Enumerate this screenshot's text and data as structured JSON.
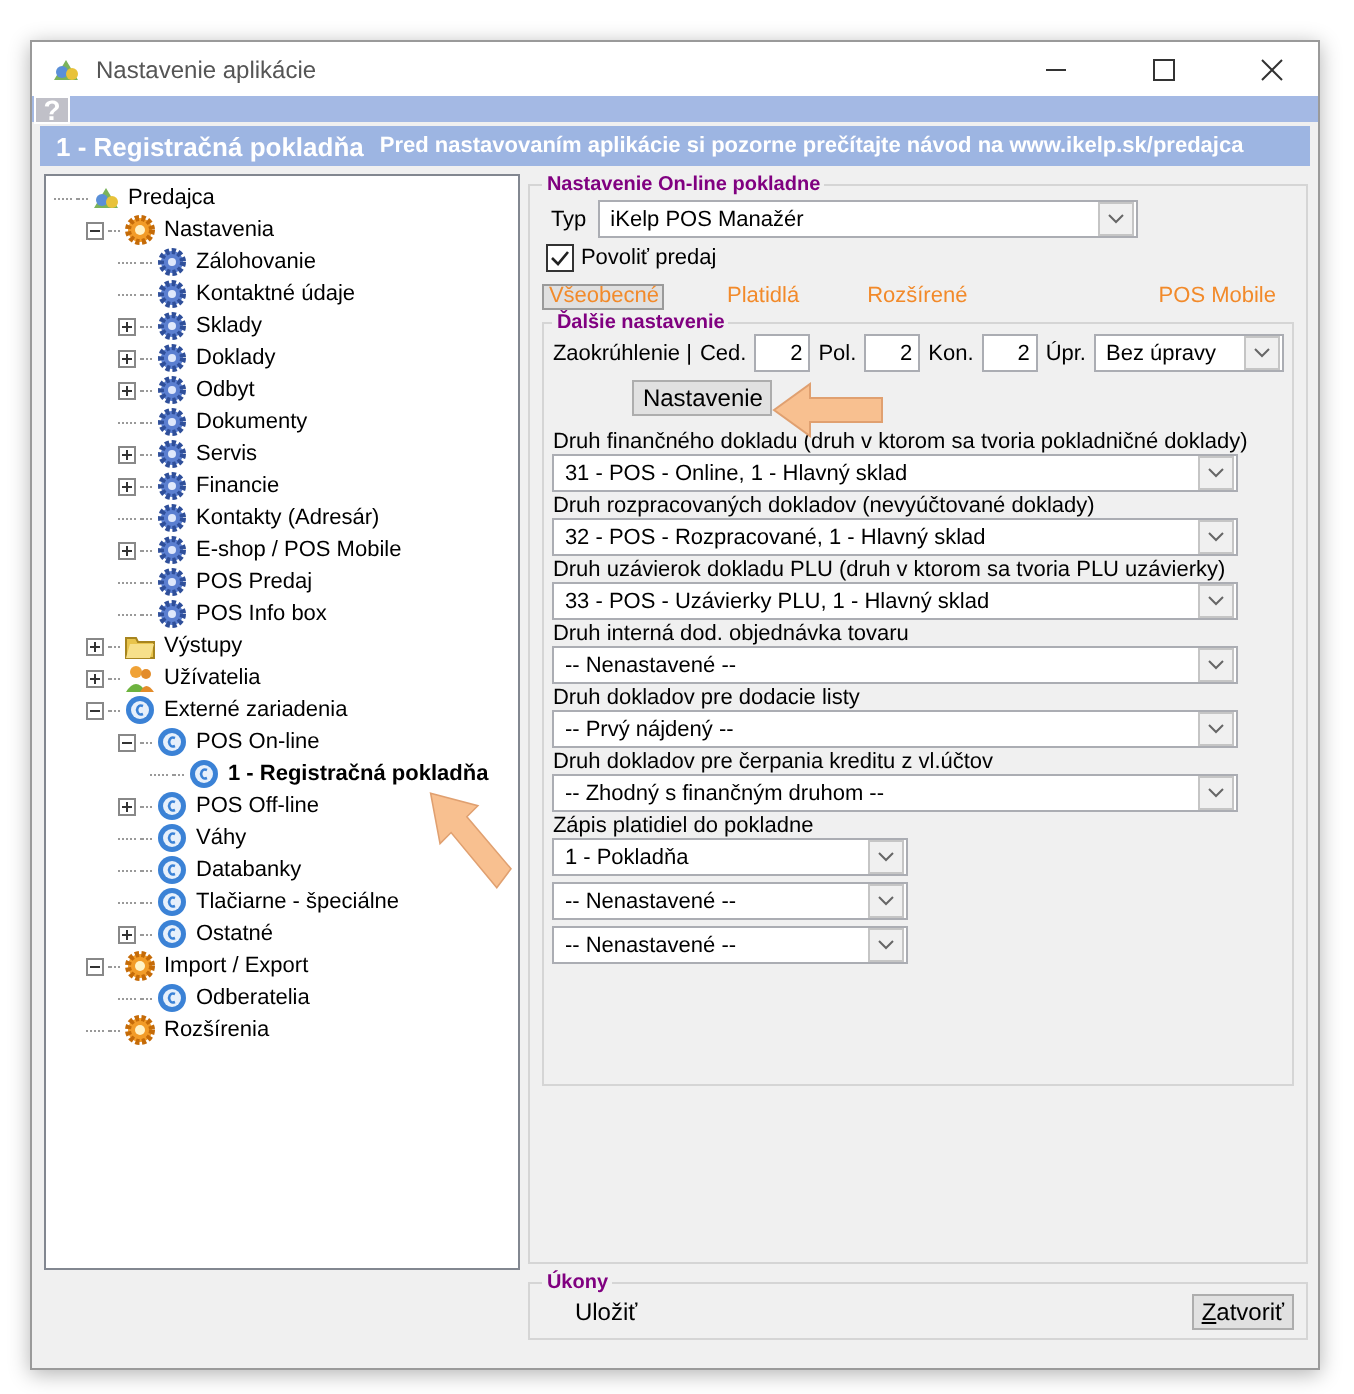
{
  "window": {
    "title": "Nastavenie aplikácie"
  },
  "help": {
    "label": "?"
  },
  "header": {
    "title": "1 - Registračná pokladňa",
    "notice": "Pred nastavovaním aplikácie si pozorne prečítajte návod na www.ikelp.sk/predajca"
  },
  "tree": [
    {
      "label": "Predajca",
      "kind": "app",
      "selected": false,
      "children": [
        {
          "label": "Nastavenia",
          "kind": "gear",
          "expanded": true,
          "selected": false,
          "children": [
            {
              "label": "Zálohovanie",
              "kind": "cog",
              "selected": false
            },
            {
              "label": "Kontaktné údaje",
              "kind": "cog",
              "selected": false
            },
            {
              "label": "Sklady",
              "kind": "cog",
              "expanded": false,
              "selected": false
            },
            {
              "label": "Doklady",
              "kind": "cog",
              "expanded": false,
              "selected": false
            },
            {
              "label": "Odbyt",
              "kind": "cog",
              "expanded": false,
              "selected": false
            },
            {
              "label": "Dokumenty",
              "kind": "cog",
              "selected": false
            },
            {
              "label": "Servis",
              "kind": "cog",
              "expanded": false,
              "selected": false
            },
            {
              "label": "Financie",
              "kind": "cog",
              "expanded": false,
              "selected": false
            },
            {
              "label": "Kontakty (Adresár)",
              "kind": "cog",
              "selected": false
            },
            {
              "label": "E-shop / POS Mobile",
              "kind": "cog",
              "expanded": false,
              "selected": false
            },
            {
              "label": "POS Predaj",
              "kind": "cog",
              "selected": false
            },
            {
              "label": "POS Info box",
              "kind": "cog",
              "selected": false
            }
          ]
        },
        {
          "label": "Výstupy",
          "kind": "folder",
          "expanded": false,
          "selected": false
        },
        {
          "label": "Užívatelia",
          "kind": "users",
          "expanded": false,
          "selected": false
        },
        {
          "label": "Externé zariadenia",
          "kind": "coin",
          "expanded": true,
          "selected": false,
          "children": [
            {
              "label": "POS On-line",
              "kind": "coin",
              "expanded": true,
              "selected": false,
              "children": [
                {
                  "label": "1 - Registračná pokladňa",
                  "kind": "coin",
                  "selected": true
                }
              ]
            },
            {
              "label": "POS Off-line",
              "kind": "coin",
              "expanded": false,
              "selected": false
            },
            {
              "label": "Váhy",
              "kind": "coin",
              "selected": false
            },
            {
              "label": "Databanky",
              "kind": "coin",
              "selected": false
            },
            {
              "label": "Tlačiarne - špeciálne",
              "kind": "coin",
              "selected": false
            },
            {
              "label": "Ostatné",
              "kind": "coin",
              "expanded": false,
              "selected": false
            }
          ]
        },
        {
          "label": "Import / Export",
          "kind": "gear",
          "expanded": true,
          "selected": false,
          "children": [
            {
              "label": "Odberatelia",
              "kind": "coin",
              "selected": false
            }
          ]
        },
        {
          "label": "Rozšírenia",
          "kind": "gear",
          "selected": false
        }
      ]
    }
  ],
  "settings": {
    "legend": "Nastavenie On-line pokladne",
    "type": {
      "label": "Typ",
      "value": "iKelp POS Manažér"
    },
    "enable_sale": {
      "label": "Povoliť predaj",
      "checked": true
    },
    "tabs": [
      {
        "label": "Všeobecné",
        "selected": true
      },
      {
        "label": "Platidlá",
        "selected": false
      },
      {
        "label": "Rozšírené",
        "selected": false
      },
      {
        "label": "POS Mobile",
        "selected": false
      }
    ],
    "more": {
      "legend": "Ďalšie nastavenie",
      "rounding": {
        "label": "Zaokrúhlenie |",
        "fields": [
          {
            "label": "Ced.",
            "value": "2"
          },
          {
            "label": "Pol.",
            "value": "2"
          },
          {
            "label": "Kon.",
            "value": "2"
          }
        ],
        "adjust_label": "Úpr.",
        "adjust_value": "Bez úpravy"
      },
      "button": "Nastavenie",
      "selects": [
        {
          "label": "Druh finančného dokladu (druh v ktorom sa tvoria pokladničné doklady)",
          "value": "31 - POS - Online, 1 - Hlavný sklad"
        },
        {
          "label": "Druh rozpracovaných dokladov (nevyúčtované doklady)",
          "value": "32 - POS - Rozpracované, 1 - Hlavný sklad"
        },
        {
          "label": "Druh uzávierok dokladu PLU (druh v ktorom sa tvoria PLU uzávierky)",
          "value": "33 - POS - Uzávierky PLU, 1 - Hlavný sklad"
        },
        {
          "label": "Druh interná dod. objednávka tovaru",
          "value": "-- Nenastavené --"
        },
        {
          "label": "Druh dokladov pre dodacie listy",
          "value": "-- Prvý nájdený --"
        },
        {
          "label": "Druh dokladov pre čerpania kreditu z vl.účtov",
          "value": "-- Zhodný s finančným druhom --"
        }
      ],
      "payments": {
        "label": "Zápis platidiel do pokladne",
        "values": [
          "1 - Pokladňa",
          "-- Nenastavené --",
          "-- Nenastavené --"
        ]
      }
    }
  },
  "actions": {
    "legend": "Úkony",
    "save": "Uložiť",
    "close": "Zatvoriť"
  }
}
